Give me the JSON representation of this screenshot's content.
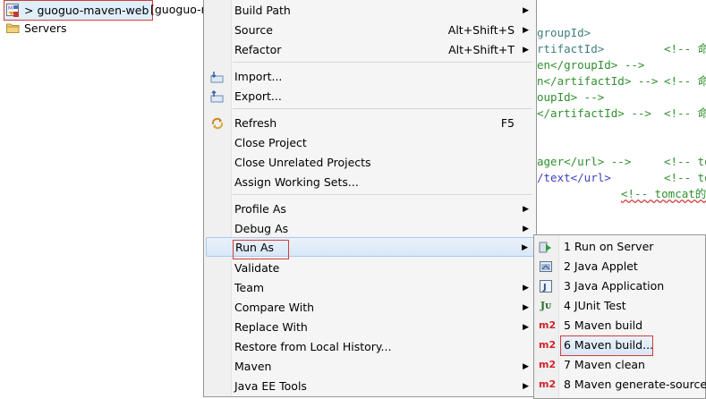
{
  "explorer": {
    "project_label": "> guoguo-maven-web",
    "project_tail": "[guoguo-r",
    "servers_label": "Servers"
  },
  "editor": {
    "lines": [
      {
        "a": "groupId>",
        "b": "",
        "c": ""
      },
      {
        "a": "rtifactId>",
        "b": "<!-- 命",
        "c": ""
      },
      {
        "a": "en</groupId> -->",
        "b": "",
        "c": ""
      },
      {
        "a": "n</artifactId> -->",
        "b": "<!-- 命",
        "c": ""
      },
      {
        "a": "oupId> -->",
        "b": "",
        "c": ""
      },
      {
        "a": "</artifactId> -->",
        "b": "<!-- 命",
        "c": ""
      },
      {
        "a": "ager</url> -->",
        "b": "<!-- to",
        "c": ""
      },
      {
        "a": "/text</url>",
        "b": "<!-- to",
        "c": ""
      },
      {
        "a": "",
        "b": "<!-- tomcat的",
        "c": ""
      }
    ]
  },
  "context_menu": {
    "items": [
      {
        "label": "Build Path",
        "shortcut": "",
        "submenu": true
      },
      {
        "label": "Source",
        "shortcut": "Alt+Shift+S",
        "submenu": true
      },
      {
        "label": "Refactor",
        "shortcut": "Alt+Shift+T",
        "submenu": true
      },
      {
        "label": "Import...",
        "shortcut": "",
        "submenu": false,
        "icon": "import-icon"
      },
      {
        "label": "Export...",
        "shortcut": "",
        "submenu": false,
        "icon": "export-icon"
      },
      {
        "label": "Refresh",
        "shortcut": "F5",
        "submenu": false,
        "icon": "refresh-icon"
      },
      {
        "label": "Close Project",
        "shortcut": "",
        "submenu": false
      },
      {
        "label": "Close Unrelated Projects",
        "shortcut": "",
        "submenu": false
      },
      {
        "label": "Assign Working Sets...",
        "shortcut": "",
        "submenu": false
      },
      {
        "label": "Profile As",
        "shortcut": "",
        "submenu": true
      },
      {
        "label": "Debug As",
        "shortcut": "",
        "submenu": true
      },
      {
        "label": "Run As",
        "shortcut": "",
        "submenu": true
      },
      {
        "label": "Validate",
        "shortcut": "",
        "submenu": false
      },
      {
        "label": "Team",
        "shortcut": "",
        "submenu": true
      },
      {
        "label": "Compare With",
        "shortcut": "",
        "submenu": true
      },
      {
        "label": "Replace With",
        "shortcut": "",
        "submenu": true
      },
      {
        "label": "Restore from Local History...",
        "shortcut": "",
        "submenu": false
      },
      {
        "label": "Maven",
        "shortcut": "",
        "submenu": true
      },
      {
        "label": "Java EE Tools",
        "shortcut": "",
        "submenu": true
      }
    ]
  },
  "run_as_menu": {
    "items": [
      {
        "label": "1 Run on Server",
        "icon": "run-on-server-icon"
      },
      {
        "label": "2 Java Applet",
        "icon": "java-applet-icon"
      },
      {
        "label": "3 Java Application",
        "icon": "java-application-icon"
      },
      {
        "label": "4 JUnit Test",
        "icon": "junit-icon"
      },
      {
        "label": "5 Maven build",
        "icon": "maven-icon"
      },
      {
        "label": "6 Maven build...",
        "icon": "maven-icon"
      },
      {
        "label": "7 Maven clean",
        "icon": "maven-icon"
      },
      {
        "label": "8 Maven generate-sources",
        "icon": "maven-icon"
      }
    ],
    "icon_text": {
      "junit": "Jᴜ",
      "maven": "m2",
      "java_app": "J"
    }
  },
  "colors": {
    "highlight_border": "#d23c3c",
    "xml_tag": "#3f7f7f",
    "comment": "#2f8f2f"
  }
}
